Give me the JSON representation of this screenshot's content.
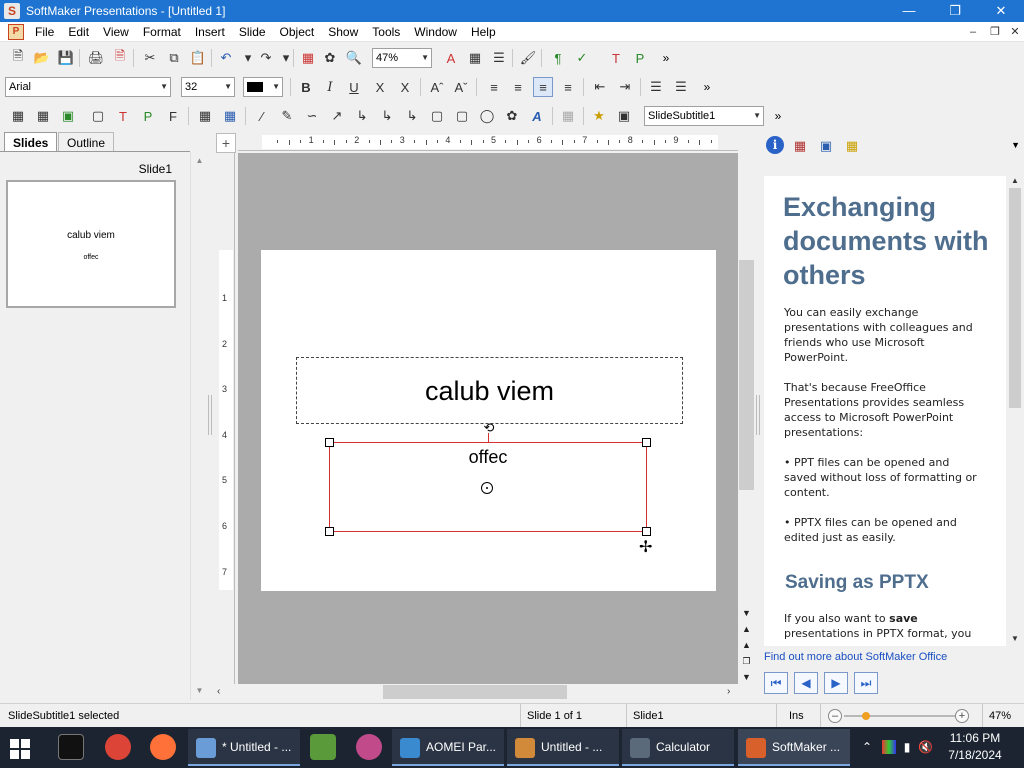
{
  "window": {
    "title": "SoftMaker Presentations - [Untitled 1]",
    "minimize_icon": "minimize-icon",
    "maximize_icon": "restore-icon",
    "close_icon": "close-icon"
  },
  "menu": {
    "items": [
      "File",
      "Edit",
      "View",
      "Format",
      "Insert",
      "Slide",
      "Object",
      "Show",
      "Tools",
      "Window",
      "Help"
    ]
  },
  "toolbar1": {
    "zoom_value": "47%"
  },
  "toolbar2": {
    "font_name": "Arial",
    "font_size": "32",
    "bold": "B",
    "italic": "I",
    "underline": "U",
    "strike": "X",
    "strike2": "X"
  },
  "toolbar3": {
    "style_value": "SlideSubtitle1"
  },
  "leftpane": {
    "tabs": [
      "Slides",
      "Outline"
    ],
    "slide_label": "Slide1",
    "thumb_title": "calub viem",
    "thumb_subtitle": "offec"
  },
  "ruler": {
    "h_numbers": [
      "1",
      "2",
      "3",
      "4",
      "5",
      "6",
      "7",
      "8",
      "9"
    ],
    "v_numbers": [
      "1",
      "2",
      "3",
      "4",
      "5",
      "6",
      "7"
    ]
  },
  "slide": {
    "title": "calub viem",
    "subtitle": "offec"
  },
  "sidebar": {
    "heading": "Exchanging documents with others",
    "para1": "You can easily exchange presentations with colleagues and friends who use Microsoft PowerPoint.",
    "para2": "That's because FreeOffice Presentations provides seamless access to Microsoft PowerPoint presentations:",
    "bullet1": "• PPT files can be opened and saved without loss of formatting or content.",
    "bullet2": "• PPTX files can be opened and edited just as easily.",
    "heading2": "Saving as PPTX",
    "para3_prefix": "If you also want to ",
    "para3_bold": "save",
    "para3_suffix": " presentations in PPTX format, you",
    "link": "Find out more about SoftMaker Office"
  },
  "status": {
    "selection": "SlideSubtitle1 selected",
    "slide_count": "Slide 1 of 1",
    "slide_name": "Slide1",
    "mode": "Ins",
    "zoom": "47%"
  },
  "taskbar": {
    "tasks": [
      "* Untitled - ...",
      "AOMEI Par...",
      "Untitled - ...",
      "Calculator",
      "SoftMaker ..."
    ],
    "time": "11:06 PM",
    "date": "7/18/2024"
  },
  "colors": {
    "titlebar": "#1e74d0",
    "heading": "#4f6e8e",
    "selection_border": "#d83030",
    "link": "#1a4fc2"
  }
}
